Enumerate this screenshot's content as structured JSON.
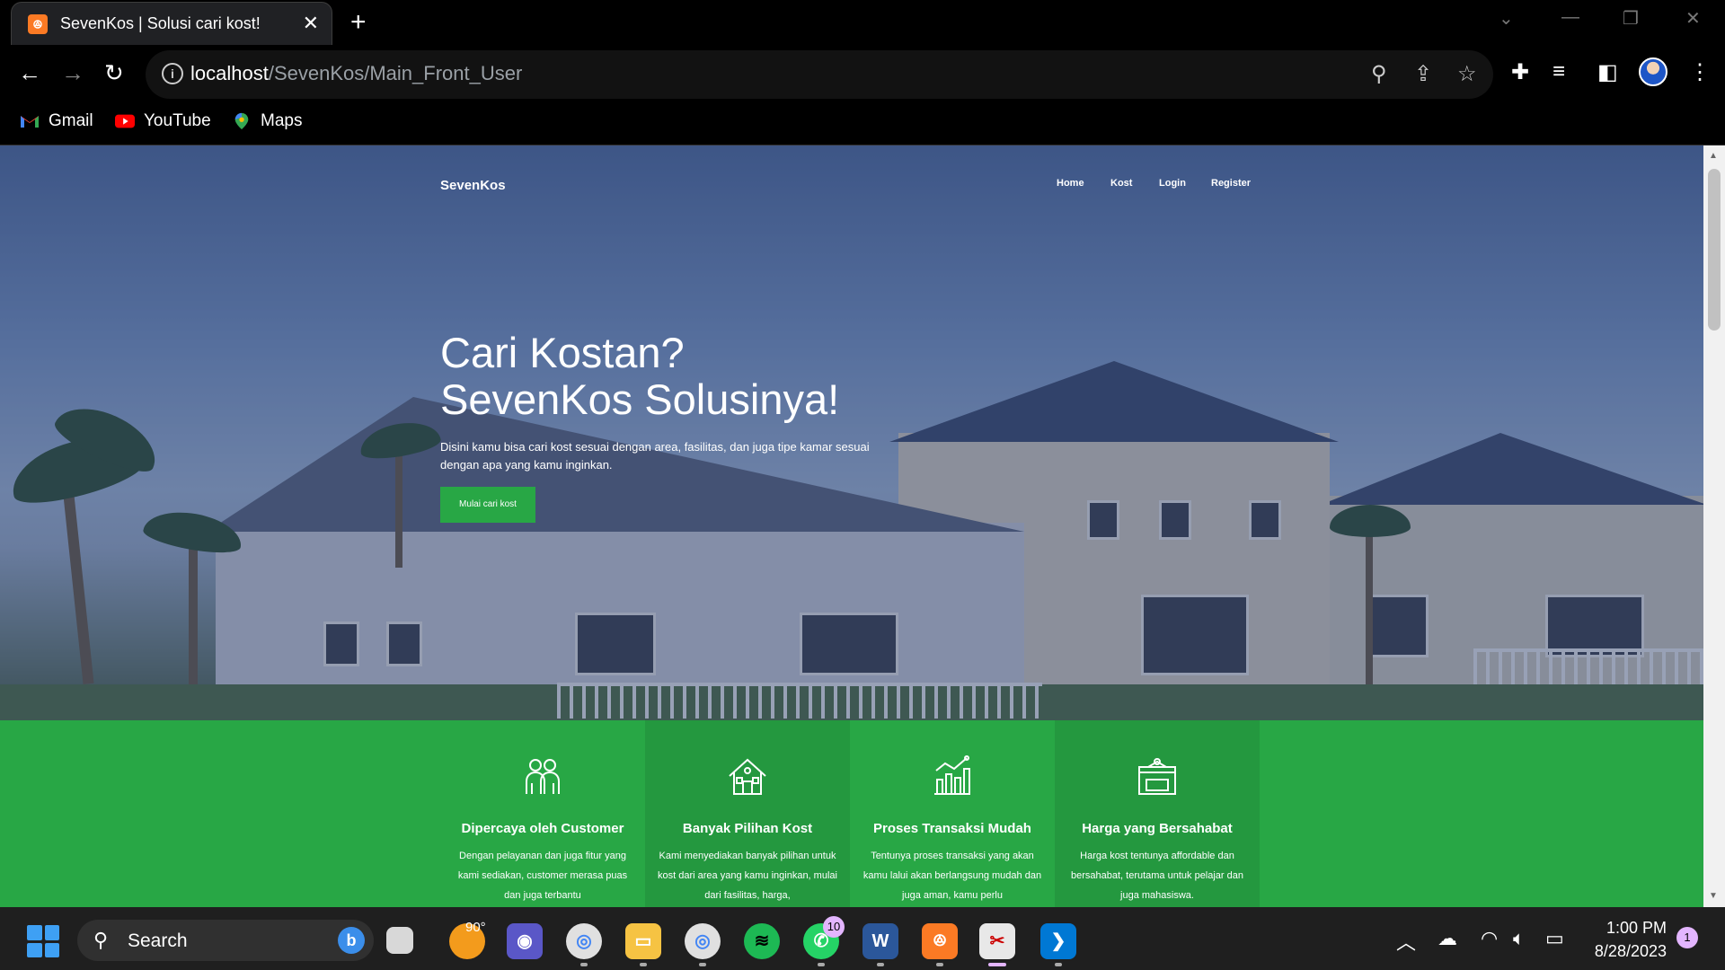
{
  "browser": {
    "tab_title": "SevenKos | Solusi cari kost!",
    "url_host": "localhost",
    "url_path": "/SevenKos/Main_Front_User",
    "bookmarks": [
      "Gmail",
      "YouTube",
      "Maps"
    ]
  },
  "site": {
    "brand": "SevenKos",
    "nav": [
      "Home",
      "Kost",
      "Login",
      "Register"
    ],
    "hero_title_line1": "Cari Kostan?",
    "hero_title_line2": "SevenKos Solusinya!",
    "hero_desc": "Disini kamu bisa cari kost sesuai dengan area, fasilitas, dan juga tipe kamar sesuai dengan apa yang kamu inginkan.",
    "hero_button": "Mulai cari kost",
    "features": [
      {
        "title": "Dipercaya oleh Customer",
        "desc": "Dengan pelayanan dan juga fitur yang kami sediakan, customer merasa puas dan juga terbantu"
      },
      {
        "title": "Banyak Pilihan Kost",
        "desc": "Kami menyediakan banyak pilihan untuk kost dari area yang kamu inginkan, mulai dari fasilitas, harga,"
      },
      {
        "title": "Proses Transaksi Mudah",
        "desc": "Tentunya proses transaksi yang akan kamu lalui akan berlangsung mudah dan juga aman, kamu perlu"
      },
      {
        "title": "Harga yang Bersahabat",
        "desc": "Harga kost tentunya affordable dan bersahabat, terutama untuk pelajar dan juga mahasiswa."
      }
    ]
  },
  "taskbar": {
    "search_label": "Search",
    "weather": "90°",
    "whatsapp_badge": "10",
    "time": "1:00 PM",
    "date": "8/28/2023",
    "notification_count": "1"
  },
  "colors": {
    "accent_green": "#28a745",
    "tab_favicon": "#fb7a24"
  }
}
